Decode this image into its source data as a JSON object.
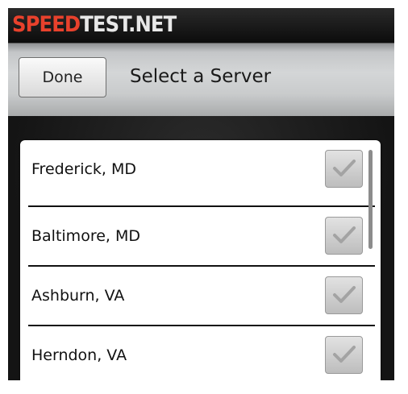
{
  "header": {
    "logo_speed": "SPEED",
    "logo_rest": "TEST.NET"
  },
  "toolbar": {
    "done_label": "Done",
    "title": "Select a Server"
  },
  "servers": [
    {
      "label": "Frederick, MD",
      "checked": false
    },
    {
      "label": "Baltimore, MD",
      "checked": false
    },
    {
      "label": "Ashburn, VA",
      "checked": false
    },
    {
      "label": "Herndon, VA",
      "checked": false
    }
  ],
  "colors": {
    "brand_red": "#e8412c",
    "brand_white": "#e8e8e8"
  }
}
